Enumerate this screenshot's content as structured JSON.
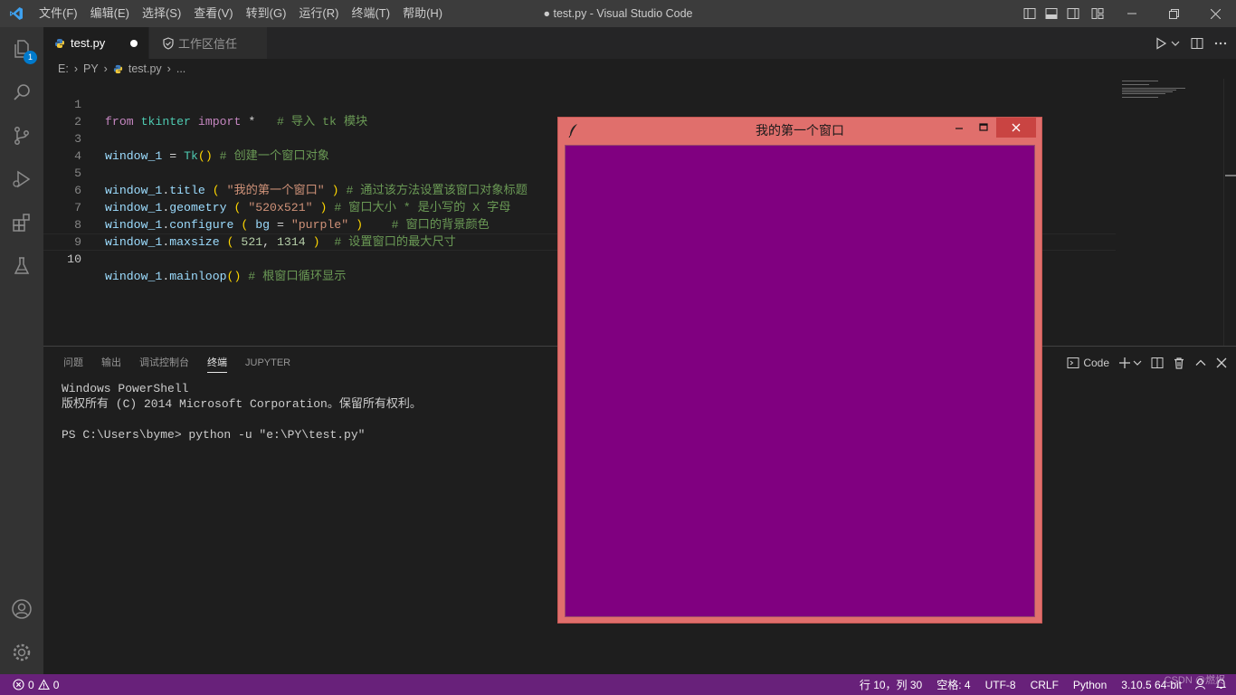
{
  "titlebar": {
    "menu": [
      "文件(F)",
      "编辑(E)",
      "选择(S)",
      "查看(V)",
      "转到(G)",
      "运行(R)",
      "终端(T)",
      "帮助(H)"
    ],
    "window_title": "● test.py - Visual Studio Code"
  },
  "activitybar": {
    "explorer_badge": "1"
  },
  "tabs": [
    {
      "label": "test.py",
      "modified": true
    },
    {
      "label": "工作区信任"
    }
  ],
  "breadcrumb": [
    "E:",
    "PY",
    "test.py",
    "..."
  ],
  "code": {
    "lines": [
      "1",
      "2",
      "3",
      "4",
      "5",
      "6",
      "7",
      "8",
      "9",
      "10"
    ],
    "l1": {
      "kw1": "from",
      "mod": "tkinter",
      "kw2": "import",
      "star": "*",
      "cm": "# 导入 tk 模块"
    },
    "l3": {
      "var": "window_1",
      "eq": "=",
      "cls": "Tk",
      "p": "()",
      "cm": "# 创建一个窗口对象"
    },
    "l5": {
      "var": "window_1",
      "dot": ".",
      "fn": "title",
      "p1": "(",
      "str": "\"我的第一个窗口\"",
      "p2": ")",
      "cm": "# 通过该方法设置该窗口对象标题"
    },
    "l6": {
      "var": "window_1",
      "dot": ".",
      "fn": "geometry",
      "p1": "(",
      "str": "\"520x521\"",
      "p2": ")",
      "cm": "# 窗口大小 * 是小写的 X 字母"
    },
    "l7": {
      "var": "window_1",
      "dot": ".",
      "fn": "configure",
      "p1": "(",
      "arg": "bg",
      "eq": "=",
      "str": "\"purple\"",
      "p2": ")",
      "cm": "# 窗口的背景颜色"
    },
    "l8": {
      "var": "window_1",
      "dot": ".",
      "fn": "maxsize",
      "p1": "(",
      "n1": "521",
      "comma": ",",
      "n2": "1314",
      "p2": ")",
      "cm": "# 设置窗口的最大尺寸"
    },
    "l10": {
      "var": "window_1",
      "dot": ".",
      "fn": "mainloop",
      "p": "()",
      "cm": "# 根窗口循环显示"
    }
  },
  "panel": {
    "tabs": [
      "问题",
      "输出",
      "调试控制台",
      "终端",
      "JUPYTER"
    ],
    "active_tab": "终端",
    "terminal_name": "Code",
    "terminal_lines": [
      "Windows PowerShell",
      "版权所有 (C) 2014 Microsoft Corporation。保留所有权利。",
      "",
      "PS C:\\Users\\byme> python -u \"e:\\PY\\test.py\""
    ]
  },
  "statusbar": {
    "errors": "0",
    "warnings": "0",
    "position": "行 10，列 30",
    "spaces": "空格: 4",
    "encoding": "UTF-8",
    "eol": "CRLF",
    "language": "Python",
    "interpreter": "3.10.5 64-bit",
    "watermark": "CSDN @燃烬"
  },
  "tk_window": {
    "title": "我的第一个窗口",
    "bg_color": "purple",
    "frame_color": "#e06f6c"
  }
}
